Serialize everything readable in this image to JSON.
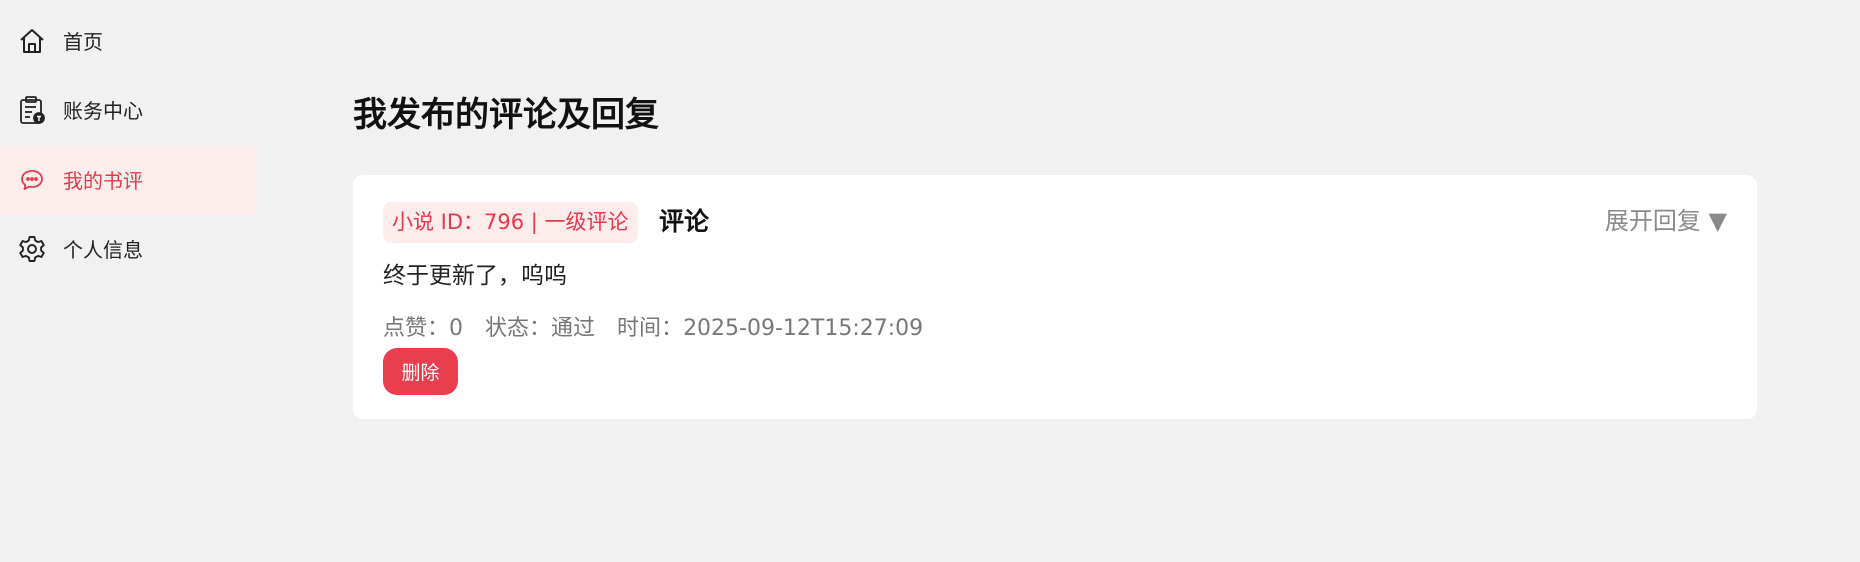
{
  "sidebar": {
    "items": [
      {
        "label": "首页",
        "icon": "home-icon"
      },
      {
        "label": "账务中心",
        "icon": "account-clipboard-icon"
      },
      {
        "label": "我的书评",
        "icon": "chat-bubble-icon",
        "active": true
      },
      {
        "label": "个人信息",
        "icon": "gear-icon"
      }
    ]
  },
  "main": {
    "title": "我发布的评论及回复",
    "comment": {
      "tag": "小说 ID：796 | 一级评论",
      "type": "评论",
      "expand_label": "展开回复 ▼",
      "content": "终于更新了，呜呜",
      "likes_label": "点赞：",
      "likes": "0",
      "status_label": "状态：",
      "status": "通过",
      "time_label": "时间：",
      "time": "2025-09-12T15:27:09",
      "delete_label": "删除"
    }
  },
  "colors": {
    "accent": "#e8394b",
    "active_bg": "#fdeeee",
    "page_bg": "#f1f1f1"
  }
}
